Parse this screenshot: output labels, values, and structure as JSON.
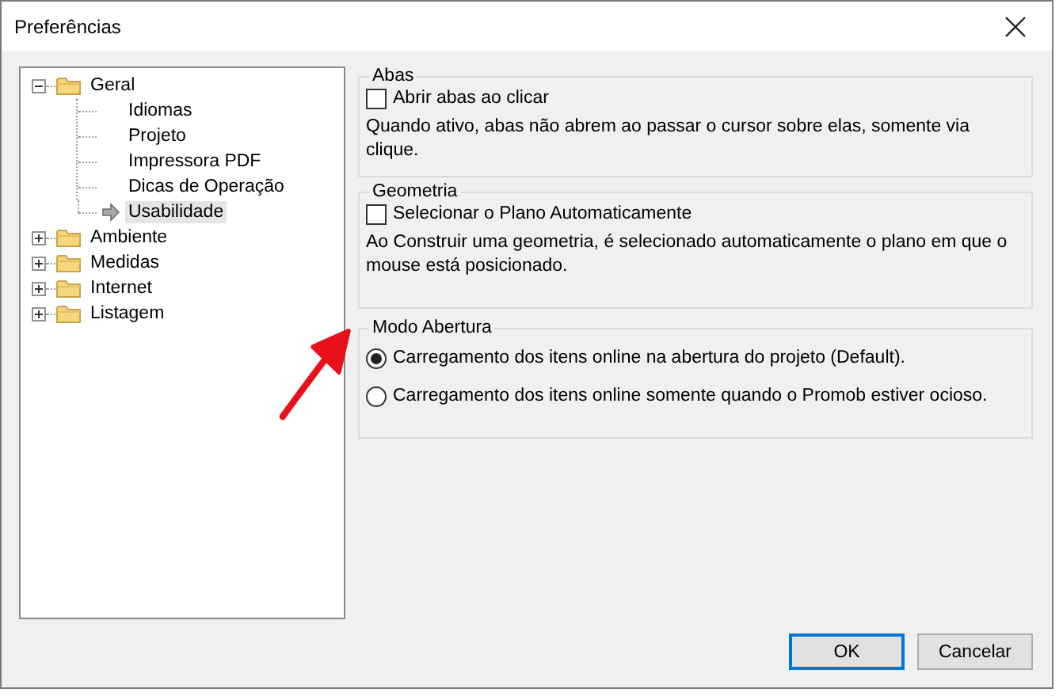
{
  "window": {
    "title": "Preferências"
  },
  "tree": [
    {
      "label": "Geral",
      "expanded": true,
      "children": [
        {
          "label": "Idiomas",
          "selected": false
        },
        {
          "label": "Projeto",
          "selected": false
        },
        {
          "label": "Impressora PDF",
          "selected": false
        },
        {
          "label": "Dicas de Operação",
          "selected": false
        },
        {
          "label": "Usabilidade",
          "selected": true
        }
      ]
    },
    {
      "label": "Ambiente",
      "expanded": false
    },
    {
      "label": "Medidas",
      "expanded": false
    },
    {
      "label": "Internet",
      "expanded": false
    },
    {
      "label": "Listagem",
      "expanded": false
    }
  ],
  "groups": [
    {
      "title": "Abas",
      "kind": "checkbox",
      "label": "Abrir abas ao clicar",
      "checked": false,
      "description": "Quando ativo, abas não abrem ao passar o cursor sobre elas, somente via clique."
    },
    {
      "title": "Geometria",
      "kind": "checkbox",
      "label": "Selecionar o Plano Automaticamente",
      "checked": false,
      "description": "Ao Construir uma geometria, é selecionado automaticamente o plano em que o mouse está posicionado."
    },
    {
      "title": "Modo Abertura",
      "kind": "radios",
      "options": [
        {
          "label": "Carregamento dos itens online na abertura do projeto (Default).",
          "selected": true
        },
        {
          "label": "Carregamento dos itens online somente quando o Promob estiver ocioso.",
          "selected": false
        }
      ]
    }
  ],
  "buttons": [
    {
      "label": "OK",
      "default": true
    },
    {
      "label": "Cancelar",
      "default": false
    }
  ]
}
